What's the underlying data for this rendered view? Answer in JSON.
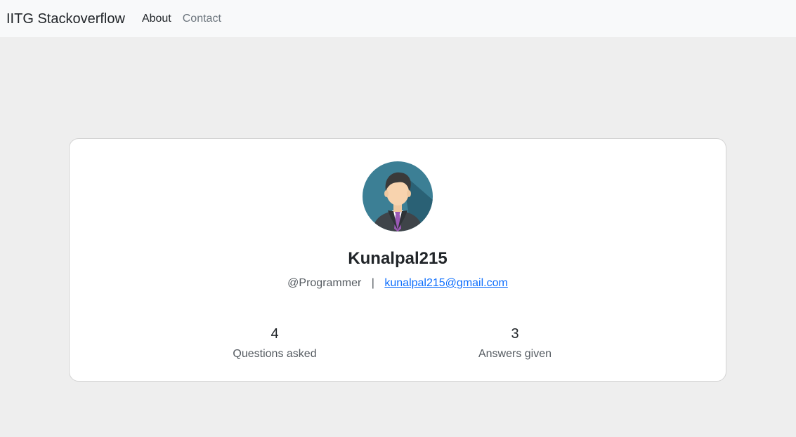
{
  "navbar": {
    "brand": "IITG Stackoverflow",
    "links": [
      {
        "label": "About"
      },
      {
        "label": "Contact"
      }
    ]
  },
  "profile": {
    "avatar_icon": "user-avatar-icon",
    "username": "Kunalpal215",
    "role": "@Programmer",
    "separator": "|",
    "email": "kunalpal215@gmail.com",
    "stats": [
      {
        "value": "4",
        "label": "Questions asked"
      },
      {
        "value": "3",
        "label": "Answers given"
      }
    ]
  },
  "colors": {
    "page_bg": "#eeeeee",
    "navbar_bg": "#f8f9fa",
    "link": "#0d6efd",
    "avatar_bg": "#3c7f95",
    "tie": "#9b59b6"
  }
}
